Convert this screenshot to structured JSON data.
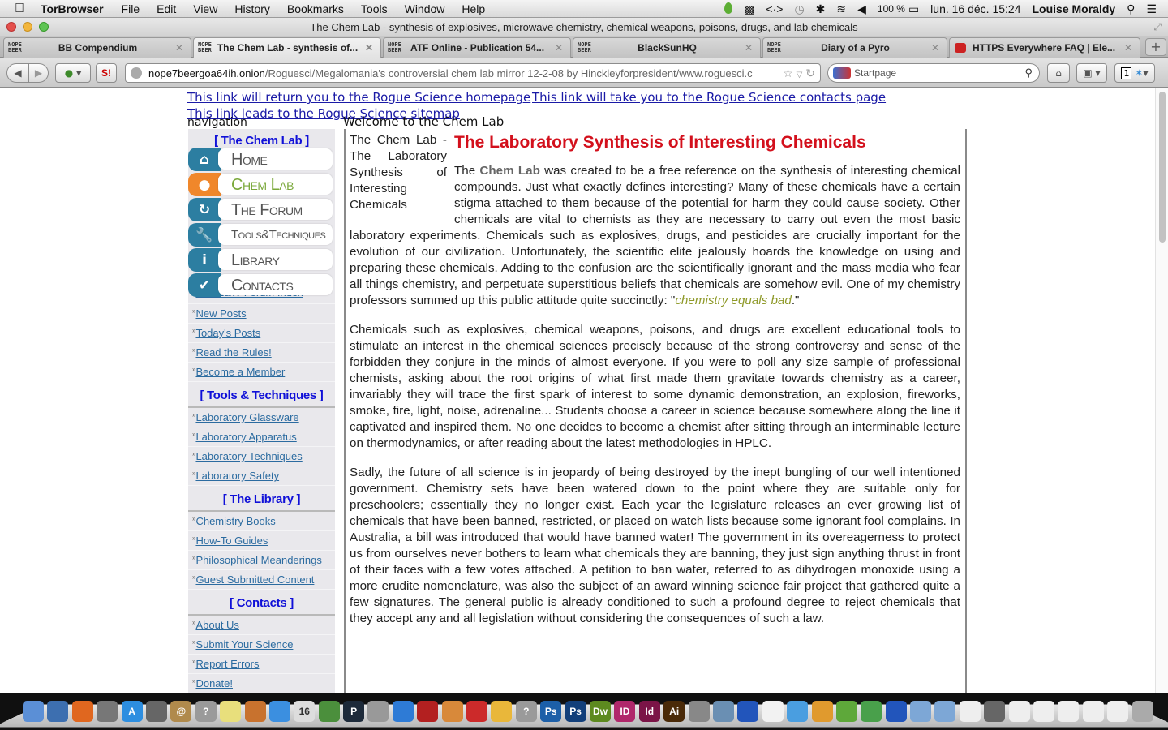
{
  "menubar": {
    "app_name": "TorBrowser",
    "items": [
      "File",
      "Edit",
      "View",
      "History",
      "Bookmarks",
      "Tools",
      "Window",
      "Help"
    ],
    "battery": "100 %",
    "datetime": "lun. 16 déc. 15:24",
    "user": "Louise Moraldy"
  },
  "window": {
    "title": "The Chem Lab - synthesis of explosives, microwave chemistry, chemical weapons, poisons, drugs, and lab chemicals"
  },
  "tabs": [
    {
      "label": "BB Compendium",
      "favicon": "NOPE BEER",
      "active": false
    },
    {
      "label": "The Chem Lab - synthesis of...",
      "favicon": "NOPE BEER",
      "active": true
    },
    {
      "label": "ATF Online - Publication 54...",
      "favicon": "NOPE BEER",
      "active": false
    },
    {
      "label": "BlackSunHQ",
      "favicon": "NOPE BEER",
      "active": false
    },
    {
      "label": "Diary of a Pyro",
      "favicon": "NOPE BEER",
      "active": false
    },
    {
      "label": "HTTPS Everywhere FAQ | Ele...",
      "favicon": "https-everywhere-icon",
      "active": false
    }
  ],
  "navbar": {
    "url_host": "nope7beergoa64ih.onion",
    "url_path": "/Roguesci/Megalomania's controversial chem lab mirror 12-2-08 by Hinckleyforpresident/www.roguesci.c",
    "search_placeholder": "Startpage",
    "addon_badge": "1"
  },
  "page": {
    "top_links": [
      "This link will return you to the Rogue Science homepage",
      "Rogue Science",
      "This link will take you to the Rogue Science contacts page",
      "This link leads to the Rogue Science sitemap"
    ],
    "navigation_label": "navigation",
    "welcome": "Welcome to the Chem Lab",
    "icon_menu": [
      {
        "label": "Home",
        "icon": "home-icon",
        "selected": false
      },
      {
        "label": "Chem Lab",
        "icon": "flask-icon",
        "selected": true
      },
      {
        "label": "The Forum",
        "icon": "refresh-icon",
        "selected": false
      },
      {
        "label": "Tools&Techniques",
        "icon": "wrench-icon",
        "selected": false
      },
      {
        "label": "Library",
        "icon": "info-icon",
        "selected": false
      },
      {
        "label": "Contacts",
        "icon": "check-icon",
        "selected": false
      }
    ],
    "sidebar": {
      "first_head": "[ The Chem Lab ]",
      "forum_index": "The E&W Forum Index",
      "forum_items": [
        "New Posts",
        "Today's Posts",
        "Read the Rules!",
        "Become a Member"
      ],
      "sections": [
        {
          "heading": "[ Tools & Techniques ]",
          "items": [
            "Laboratory Glassware",
            "Laboratory Apparatus",
            "Laboratory Techniques",
            "Laboratory Safety"
          ]
        },
        {
          "heading": "[ The Library ]",
          "items": [
            "Chemistry Books",
            "How-To Guides",
            "Philosophical Meanderings",
            "Guest Submitted Content"
          ]
        },
        {
          "heading": "[ Contacts ]",
          "items": [
            "About Us",
            "Submit Your Science",
            "Report Errors",
            "Donate!"
          ]
        }
      ]
    },
    "content": {
      "side_title": "The Chem Lab - The Laboratory Synthesis of Interesting Chemicals",
      "heading": "The Laboratory Synthesis of Interesting Chemicals",
      "p1_pre": "The ",
      "p1_highlight": "Chem Lab",
      "p1_post": " was created to be a free reference on the synthesis of interesting chemical compounds. Just what exactly defines interesting? Many of these chemicals have a certain stigma attached to them because of the potential for harm they could cause society.  Other chemicals are vital to chemists as they are necessary to carry out even the most basic laboratory experiments.  Chemicals such as explosives, drugs, and pesticides are crucially important for the evolution of our civilization.  Unfortunately, the scientific elite jealously hoards the knowledge on using and preparing these chemicals. Adding to the confusion are the scientifically ignorant and the mass media who fear all things chemistry, and perpetuate superstitious beliefs that chemicals are somehow evil. One of my chemistry professors summed up this public attitude quite succinctly: \"",
      "p1_quote": "chemistry equals bad",
      "p1_end": ".\"",
      "p2": "Chemicals such as explosives, chemical weapons, poisons, and drugs are excellent educational tools to stimulate an interest in the chemical sciences precisely because of the strong controversy and sense of the forbidden they conjure in the minds of almost everyone.  If you were to poll any size sample of professional chemists, asking about the root origins of what first made them gravitate towards chemistry as a career, invariably they will trace the first spark of interest to some dynamic demonstration, an explosion, fireworks, smoke, fire, light, noise, adrenaline... Students choose a career in science because somewhere along the line it captivated and inspired them.  No one decides to become a chemist after sitting through an interminable lecture on thermodynamics, or after reading about the latest methodologies in HPLC.",
      "p3": "Sadly, the future of all science is in jeopardy of being destroyed by the inept bungling of our well intentioned government.  Chemistry sets have been watered down to the point where they are suitable only for preschoolers; essentially they no longer exist.  Each year the legislature releases an ever growing list of chemicals that have been banned, restricted, or placed on watch lists because some ignorant fool complains.  In Australia, a bill was introduced that would have banned water!  The government in its overeagerness to protect us from ourselves never bothers to learn what chemicals they are banning, they just sign anything thrust in front of their faces with a few votes attached.  A petition to ban water, referred to as dihydrogen monoxide using a more erudite nomenclature, was also the subject of an award winning science fair project that gathered quite a few signatures.  The general public is already conditioned to such a profound degree to reject chemicals that they accept any and all legislation without considering the consequences of such a law."
    }
  },
  "dock": {
    "icons": [
      {
        "name": "finder-icon",
        "color": "#5b8fd6",
        "glyph": ""
      },
      {
        "name": "thunderbird-icon",
        "color": "#3d6fb0",
        "glyph": ""
      },
      {
        "name": "firefox-icon",
        "color": "#e0671f",
        "glyph": ""
      },
      {
        "name": "launchpad-icon",
        "color": "#777777",
        "glyph": ""
      },
      {
        "name": "app-store-icon",
        "color": "#2d8ee0",
        "glyph": "A"
      },
      {
        "name": "photo-icon",
        "color": "#666666",
        "glyph": ""
      },
      {
        "name": "address-book-icon",
        "color": "#b08a4c",
        "glyph": "@"
      },
      {
        "name": "question-icon",
        "color": "#9a9a9a",
        "glyph": "?"
      },
      {
        "name": "notes-icon",
        "color": "#e8df7c",
        "glyph": ""
      },
      {
        "name": "keynote-icon",
        "color": "#c8722e",
        "glyph": ""
      },
      {
        "name": "dropbox-icon",
        "color": "#3b8fe0",
        "glyph": ""
      },
      {
        "name": "calendar-icon",
        "color": "#dddddd",
        "glyph": "16"
      },
      {
        "name": "numbers-icon",
        "color": "#4b8f3c",
        "glyph": ""
      },
      {
        "name": "p-app-icon",
        "color": "#1d2a3a",
        "glyph": "P"
      },
      {
        "name": "printer-icon",
        "color": "#999999",
        "glyph": ""
      },
      {
        "name": "itunes-icon",
        "color": "#2e7bd6",
        "glyph": ""
      },
      {
        "name": "photo-booth-icon",
        "color": "#b32020",
        "glyph": ""
      },
      {
        "name": "pages-icon",
        "color": "#d8893a",
        "glyph": ""
      },
      {
        "name": "tomato-icon",
        "color": "#cc2a2a",
        "glyph": ""
      },
      {
        "name": "cyberduck-icon",
        "color": "#e9b73a",
        "glyph": ""
      },
      {
        "name": "question-icon",
        "color": "#9a9a9a",
        "glyph": "?"
      },
      {
        "name": "photoshop-icon",
        "color": "#1c5fa8",
        "glyph": "Ps"
      },
      {
        "name": "photoshop-icon",
        "color": "#123f7a",
        "glyph": "Ps"
      },
      {
        "name": "dreamweaver-icon",
        "color": "#5d8a1f",
        "glyph": "Dw"
      },
      {
        "name": "indesign-icon",
        "color": "#b0286b",
        "glyph": "ID"
      },
      {
        "name": "indesign-icon",
        "color": "#7b1447",
        "glyph": "Id"
      },
      {
        "name": "illustrator-icon",
        "color": "#4a2a08",
        "glyph": "Ai"
      },
      {
        "name": "automator-icon",
        "color": "#888888",
        "glyph": ""
      },
      {
        "name": "preview-icon",
        "color": "#6a8fb3",
        "glyph": ""
      },
      {
        "name": "vuze-icon",
        "color": "#2255bb",
        "glyph": ""
      },
      {
        "name": "document-icon",
        "color": "#f2f2f2",
        "glyph": ""
      },
      {
        "name": "safari-icon",
        "color": "#4a9ee0",
        "glyph": ""
      },
      {
        "name": "archive-icon",
        "color": "#e09a2e",
        "glyph": ""
      },
      {
        "name": "tor-icon",
        "color": "#5ea83a",
        "glyph": ""
      },
      {
        "name": "globe-icon",
        "color": "#49a04b",
        "glyph": ""
      },
      {
        "name": "vuze-icon",
        "color": "#2255bb",
        "glyph": ""
      },
      {
        "name": "folder-icon",
        "color": "#7da7d6",
        "glyph": ""
      },
      {
        "name": "folder-icon",
        "color": "#7da7d6",
        "glyph": ""
      },
      {
        "name": "window-thumbnail-icon",
        "color": "#eeeeee",
        "glyph": ""
      },
      {
        "name": "window-thumbnail-icon",
        "color": "#666666",
        "glyph": ""
      },
      {
        "name": "window-thumbnail-icon",
        "color": "#eeeeee",
        "glyph": ""
      },
      {
        "name": "window-thumbnail-icon",
        "color": "#eeeeee",
        "glyph": ""
      },
      {
        "name": "window-thumbnail-icon",
        "color": "#eeeeee",
        "glyph": ""
      },
      {
        "name": "window-thumbnail-icon",
        "color": "#eeeeee",
        "glyph": ""
      },
      {
        "name": "window-thumbnail-icon",
        "color": "#eeeeee",
        "glyph": ""
      },
      {
        "name": "trash-icon",
        "color": "#aaaaaa",
        "glyph": ""
      }
    ]
  },
  "colors": {
    "heading_red": "#d3101c",
    "sidebar_heading_blue": "#1010d8",
    "link_blue": "#1a1aa6",
    "sidebar_link": "#2b6ba0",
    "menu_teal": "#2c7ea1",
    "menu_orange": "#f0872b",
    "selected_green": "#7aa83a",
    "quote_olive": "#8f9a2a"
  }
}
